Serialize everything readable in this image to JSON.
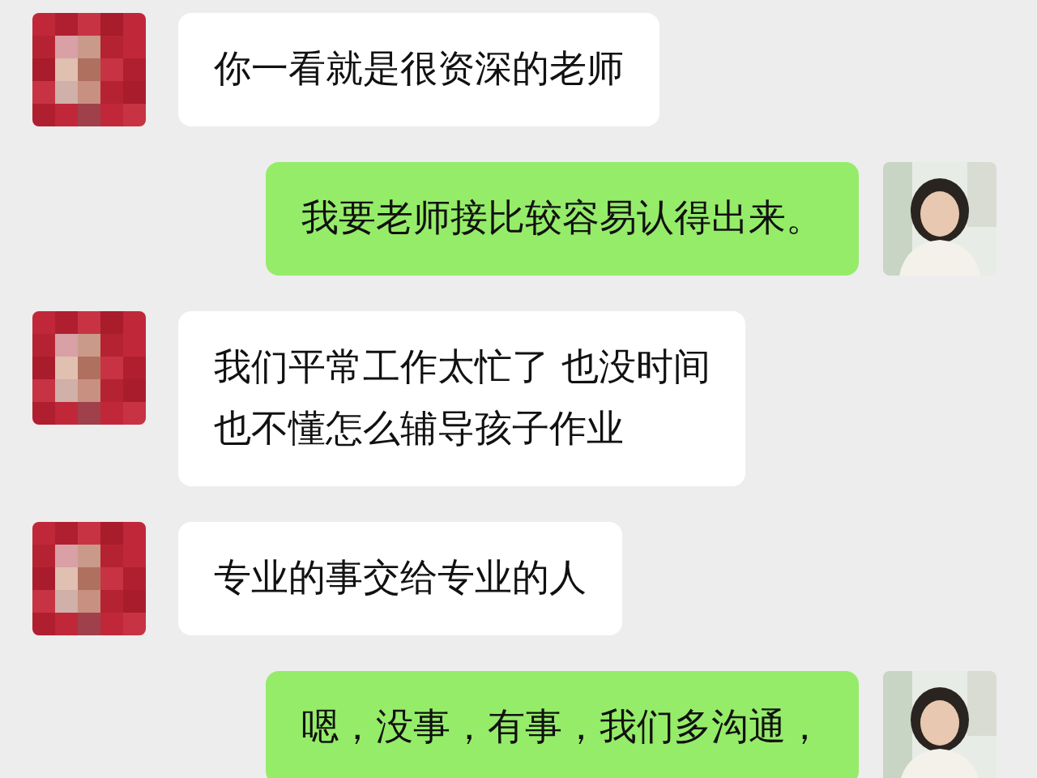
{
  "messages": [
    {
      "outgoing": false,
      "avatar": {
        "kind": "picture"
      },
      "lines": [
        "你一看就是很资深的老师"
      ]
    },
    {
      "outgoing": true,
      "avatar": {
        "kind": "picture"
      },
      "lines": [
        "我要老师接比较容易认得出来。"
      ]
    },
    {
      "outgoing": false,
      "avatar": {
        "kind": "picture"
      },
      "lines": [
        "我们平常工作太忙了 也没时间",
        "也不懂怎么辅导孩子作业"
      ]
    },
    {
      "outgoing": false,
      "avatar": {
        "kind": "picture"
      },
      "lines": [
        "专业的事交给专业的人"
      ]
    },
    {
      "outgoing": true,
      "avatar": {
        "kind": "picture"
      },
      "lines": [
        "嗯，没事，有事，我们多沟通，"
      ]
    }
  ]
}
